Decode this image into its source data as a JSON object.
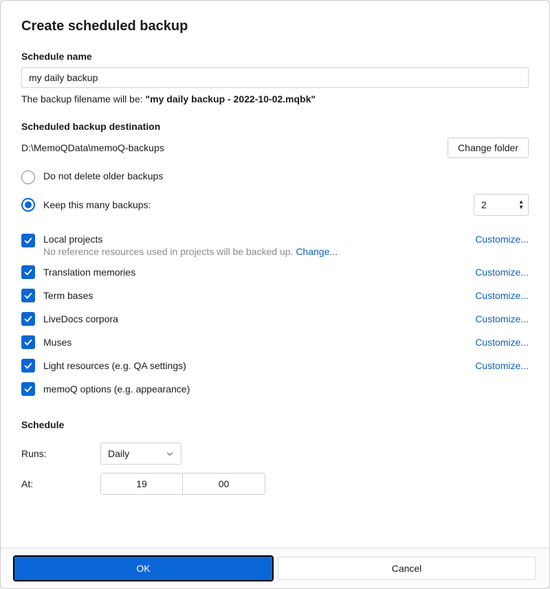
{
  "dialog": {
    "title": "Create scheduled backup"
  },
  "schedule_name": {
    "label": "Schedule name",
    "value": "my daily backup",
    "note_prefix": "The backup filename will be: ",
    "note_value": "\"my daily backup - 2022-10-02.mqbk\""
  },
  "destination": {
    "label": "Scheduled backup destination",
    "path": "D:\\MemoQData\\memoQ-backups",
    "change_folder": "Change folder"
  },
  "retention": {
    "do_not_delete": "Do not delete older backups",
    "keep_this_many": "Keep this many backups:",
    "keep_count": "2"
  },
  "resources": {
    "customize": "Customize...",
    "local_projects": {
      "label": "Local projects",
      "sub_prefix": "No reference resources used in projects will be backed up. ",
      "change": "Change..."
    },
    "translation_memories": "Translation memories",
    "term_bases": "Term bases",
    "livedocs": "LiveDocs corpora",
    "muses": "Muses",
    "light_resources": "Light resources (e.g. QA settings)",
    "memoq_options": "memoQ options (e.g. appearance)"
  },
  "schedule": {
    "heading": "Schedule",
    "runs_label": "Runs:",
    "runs_value": "Daily",
    "at_label": "At:",
    "hour": "19",
    "minute": "00"
  },
  "buttons": {
    "ok": "OK",
    "cancel": "Cancel"
  }
}
